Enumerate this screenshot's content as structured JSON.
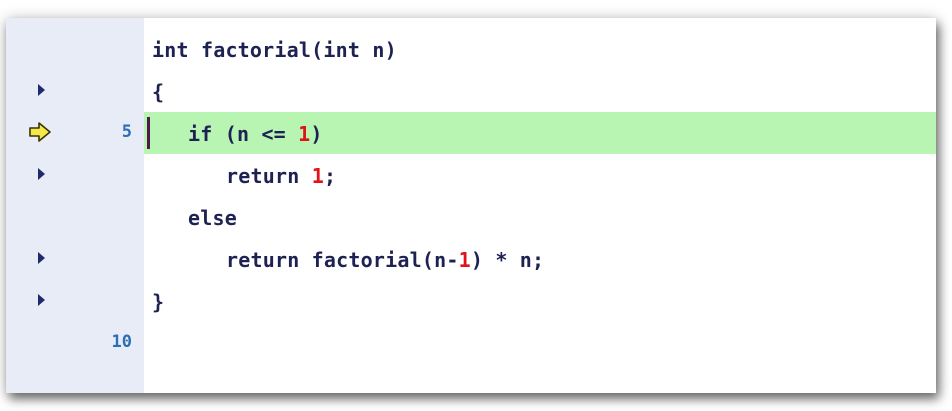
{
  "editor": {
    "current_line_number": "5",
    "last_line_number": "10",
    "colors": {
      "gutter": "#e7ecf6",
      "current_line_highlight": "#b9f5b2",
      "breakpoint_marker": "#1d2a6e",
      "execution_arrow": "#f5e84a",
      "number_literal": "#e0121a",
      "code_text": "#1e2252",
      "line_number": "#2b6fb5"
    },
    "icons": {
      "execution_pointer": "yellow-arrow-icon",
      "line_marker": "triangle-right-icon"
    },
    "lines": [
      {
        "a": "int factorial(int n)"
      },
      {
        "a": "{"
      },
      {
        "a": "if (n <= ",
        "num": "1",
        "b": ")"
      },
      {
        "a": "return ",
        "num": "1",
        "b": ";"
      },
      {
        "a": "else"
      },
      {
        "a": "return factorial(n-",
        "num": "1",
        "b": ") * n;"
      },
      {
        "a": "}"
      },
      {
        "a": ""
      }
    ]
  }
}
